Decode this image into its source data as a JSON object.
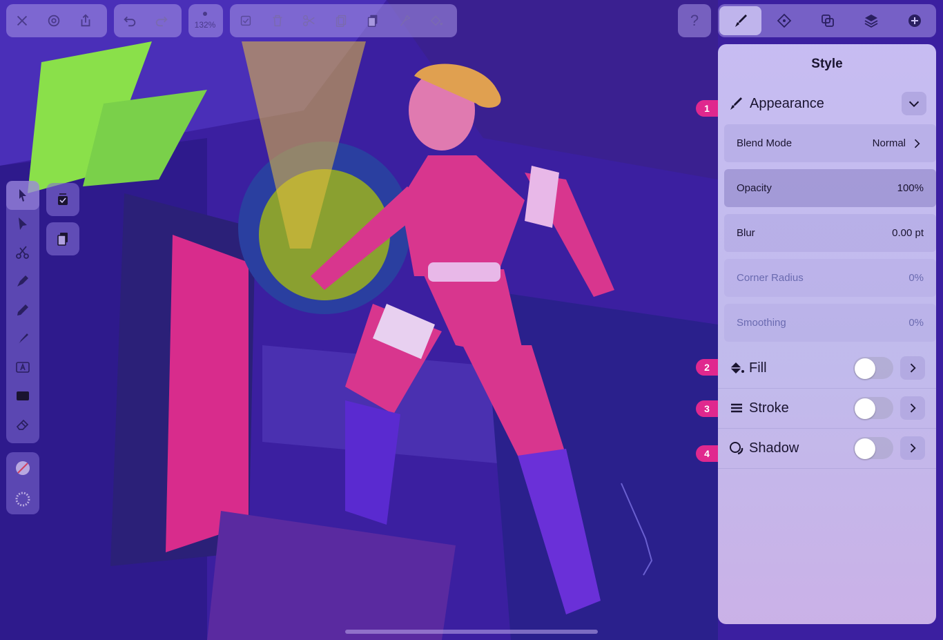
{
  "toolbar": {
    "zoom": "132%",
    "left_icons": [
      "close-icon",
      "settings-icon",
      "share-icon"
    ],
    "history_icons": [
      "undo-icon",
      "redo-icon"
    ],
    "edit_icons": [
      "select-all-icon",
      "trash-icon",
      "scissors-icon",
      "copy-icon",
      "paste-icon",
      "paste-style-icon",
      "fill-bucket-icon"
    ]
  },
  "help": {
    "label": "?"
  },
  "tabs": [
    {
      "name": "style",
      "icon": "brush-icon",
      "active": true
    },
    {
      "name": "path",
      "icon": "diamond-icon",
      "active": false
    },
    {
      "name": "boolean",
      "icon": "boolean-icon",
      "active": false
    },
    {
      "name": "layers",
      "icon": "layers-icon",
      "active": false
    },
    {
      "name": "add",
      "icon": "plus-circle-icon",
      "active": false
    }
  ],
  "panel": {
    "title": "Style",
    "appearance": {
      "label": "Appearance",
      "rows": [
        {
          "label": "Blend Mode",
          "value": "Normal"
        },
        {
          "label": "Opacity",
          "value": "100%"
        },
        {
          "label": "Blur",
          "value": "0.00 pt"
        },
        {
          "label": "Corner Radius",
          "value": "0%"
        },
        {
          "label": "Smoothing",
          "value": "0%"
        }
      ]
    },
    "props": [
      {
        "label": "Fill",
        "enabled": false
      },
      {
        "label": "Stroke",
        "enabled": false
      },
      {
        "label": "Shadow",
        "enabled": false
      }
    ]
  },
  "markers": [
    "1",
    "2",
    "3",
    "4"
  ],
  "tools": [
    "select-arrow-icon",
    "direct-select-icon",
    "scissors-icon",
    "pen-icon",
    "pencil-icon",
    "brush-icon",
    "text-icon",
    "rectangle-icon",
    "eraser-icon"
  ],
  "colors": {
    "accent": "#e0288e",
    "panel": "#cdc3f5",
    "canvas_bg": "#3b1fa0"
  }
}
